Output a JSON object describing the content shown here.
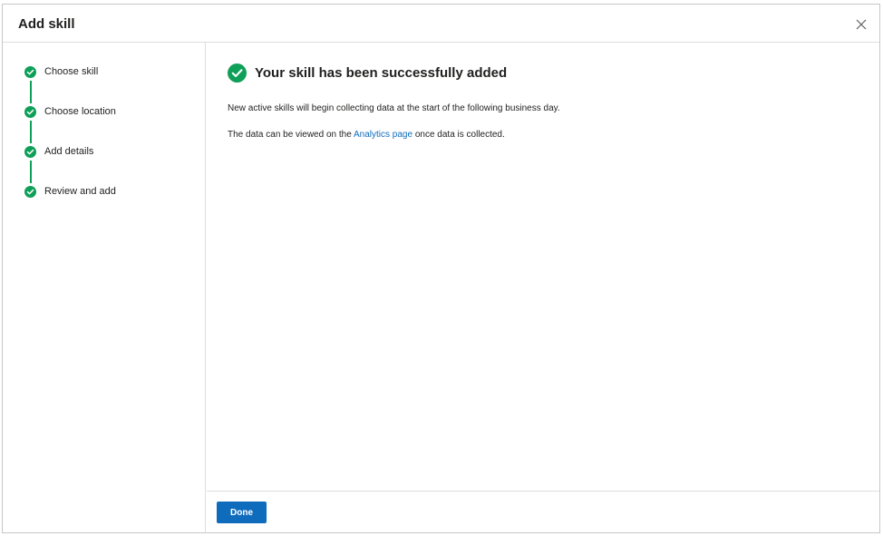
{
  "dialog": {
    "title": "Add skill",
    "close_icon": "close-icon"
  },
  "steps": [
    {
      "label": "Choose skill",
      "status": "complete"
    },
    {
      "label": "Choose location",
      "status": "complete"
    },
    {
      "label": "Add details",
      "status": "complete"
    },
    {
      "label": "Review and add",
      "status": "complete"
    }
  ],
  "main": {
    "heading": "Your skill has been successfully added",
    "paragraph1": "New active skills will begin collecting data at the start of the following business day.",
    "paragraph2_before": "The data can be viewed on the ",
    "paragraph2_link": "Analytics page",
    "paragraph2_after": " once data is collected."
  },
  "footer": {
    "done_label": "Done"
  },
  "colors": {
    "accent": "#0f6cbd",
    "success": "#0e9f58"
  }
}
